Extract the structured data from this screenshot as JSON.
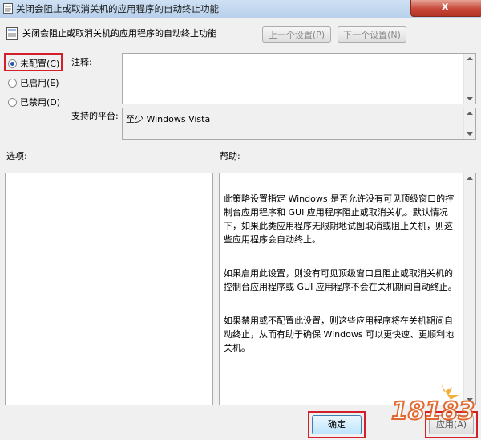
{
  "window": {
    "title": "关闭会阻止或取消关机的应用程序的自动终止功能",
    "close_glyph": "x"
  },
  "header": {
    "setting_name": "关闭会阻止或取消关机的应用程序的自动终止功能",
    "prev_button": "上一个设置(P)",
    "next_button": "下一个设置(N)"
  },
  "state_options": [
    {
      "label": "未配置(C)",
      "selected": true
    },
    {
      "label": "已启用(E)",
      "selected": false
    },
    {
      "label": "已禁用(D)",
      "selected": false
    }
  ],
  "comment": {
    "label": "注释:",
    "value": ""
  },
  "supported_on": {
    "label": "支持的平台:",
    "value": "至少 Windows Vista"
  },
  "options": {
    "label": "选项:"
  },
  "help": {
    "label": "帮助:",
    "paragraphs": [
      "此策略设置指定 Windows 是否允许没有可见顶级窗口的控制台应用程序和 GUI 应用程序阻止或取消关机。默认情况下，如果此类应用程序无限期地试图取消或阻止关机，则这些应用程序会自动终止。",
      "如果启用此设置，则没有可见顶级窗口且阻止或取消关机的控制台应用程序或 GUI 应用程序不会在关机期间自动终止。",
      "如果禁用或不配置此设置，则这些应用程序将在关机期间自动终止，从而有助于确保 Windows 可以更快速、更顺利地关机。"
    ]
  },
  "footer": {
    "ok_button": "确定",
    "apply_button": "应用(A)"
  },
  "watermark": {
    "text": "18183"
  },
  "colors": {
    "highlight_frame": "#d1202a",
    "selected_radio": "#1f58b5"
  }
}
